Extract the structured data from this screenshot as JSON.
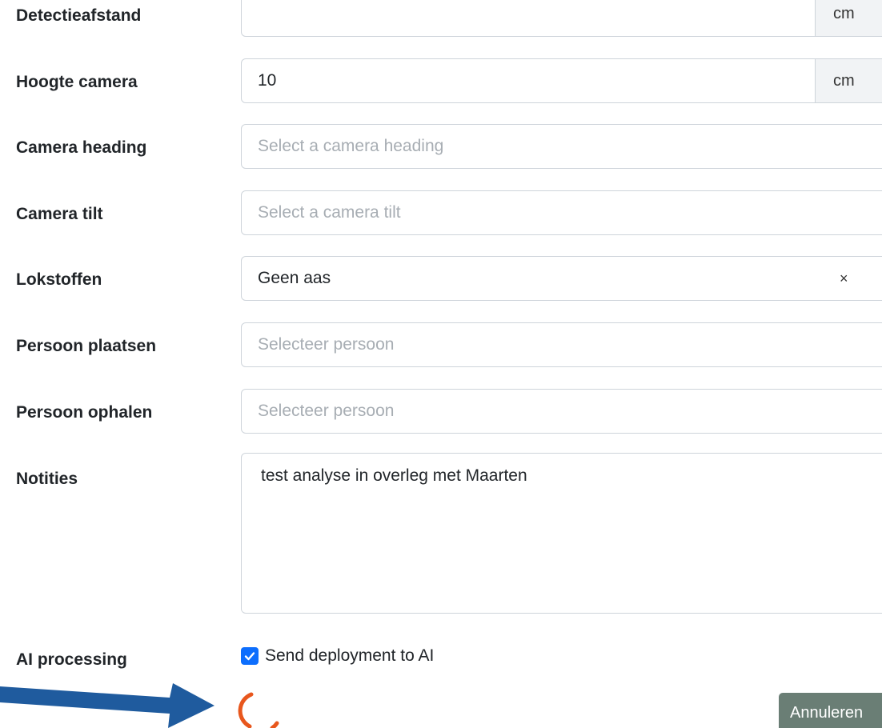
{
  "form": {
    "detectieafstand": {
      "label": "Detectieafstand",
      "value": "",
      "unit": "cm"
    },
    "hoogte_camera": {
      "label": "Hoogte camera",
      "value": "10",
      "unit": "cm"
    },
    "camera_heading": {
      "label": "Camera heading",
      "placeholder": "Select a camera heading"
    },
    "camera_tilt": {
      "label": "Camera tilt",
      "placeholder": "Select a camera tilt"
    },
    "lokstoffen": {
      "label": "Lokstoffen",
      "value": "Geen aas",
      "clear": "×"
    },
    "persoon_plaatsen": {
      "label": "Persoon plaatsen",
      "placeholder": "Selecteer persoon"
    },
    "persoon_ophalen": {
      "label": "Persoon ophalen",
      "placeholder": "Selecteer persoon"
    },
    "notities": {
      "label": "Notities",
      "value": "test analyse in overleg met Maarten"
    },
    "ai_processing": {
      "label": "AI processing",
      "checkbox_label": "Send deployment to AI",
      "checked": true
    }
  },
  "actions": {
    "cancel_label": "Annuleren"
  },
  "colors": {
    "spinner": "#e8571d",
    "arrow": "#1f5b9e",
    "checkbox": "#0d6efd",
    "cancel_button": "#6a7e75"
  },
  "icons": {
    "spinner": "loading-spinner-icon",
    "arrow": "arrow-right-icon",
    "check": "checkmark-icon",
    "clear": "close-icon"
  }
}
